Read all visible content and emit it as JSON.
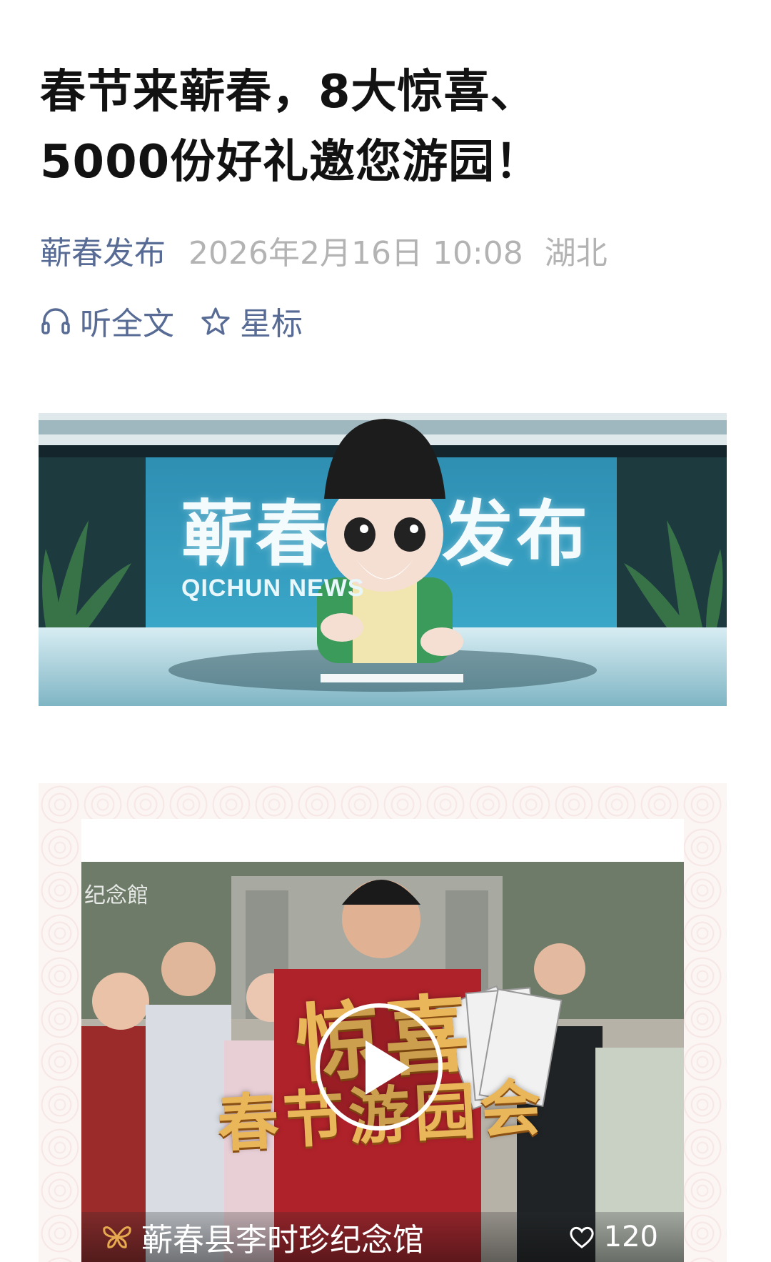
{
  "article": {
    "title_line1": "春节来蕲春，8大惊喜、",
    "title_line2": "5000份好礼邀您游园！",
    "author": "蕲春发布",
    "date": "2026年2月16日 10:08",
    "location": "湖北"
  },
  "actions": {
    "listen_icon": "headphones-icon",
    "listen_label": "听全文",
    "star_icon": "star-icon",
    "star_label": "星标"
  },
  "banner": {
    "title_left": "蕲春",
    "title_right": "发布",
    "subtitle": "QICHUN NEWS"
  },
  "video": {
    "watermark": "纪念館",
    "overlay_line1": "惊喜",
    "overlay_line2": "春节游园会",
    "channel_icon": "butterfly-icon",
    "channel_name": "蕲春县李时珍纪念馆",
    "likes_icon": "heart-icon",
    "likes": "120"
  },
  "colors": {
    "link_blue": "#576b95",
    "meta_gray": "#b3b3b3",
    "title_black": "#121212"
  }
}
